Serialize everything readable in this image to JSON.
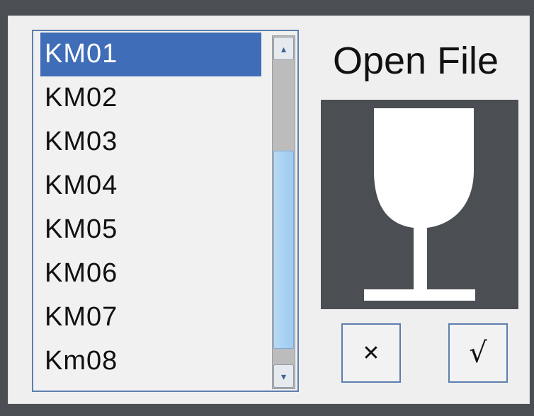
{
  "dialog": {
    "title": "Open File"
  },
  "file_list": {
    "items": [
      "KM01",
      "KM02",
      "KM03",
      "KM04",
      "KM05",
      "KM06",
      "KM07",
      "Km08"
    ],
    "selected_index": 0
  },
  "scrollbar": {
    "up_icon": "▴",
    "down_icon": "▾"
  },
  "buttons": {
    "cancel_icon": "✕",
    "confirm_icon": "√"
  },
  "preview": {
    "icon": "fragile-glass-icon"
  },
  "colors": {
    "selection": "#3f6db7",
    "border": "#5d7fae",
    "preview_bg": "#4b4f53",
    "scroll_thumb": "#a8d0f0"
  }
}
